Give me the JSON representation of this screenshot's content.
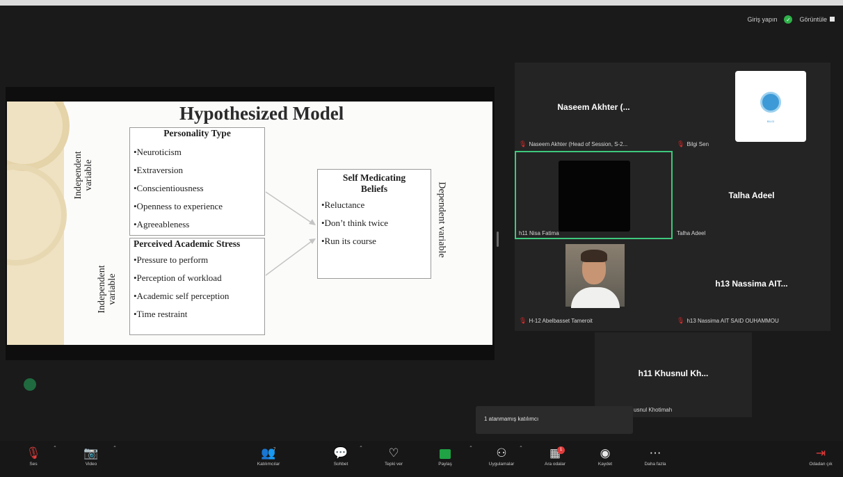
{
  "topbar": {
    "login_label": "Giriş yapın",
    "view_label": "Görüntüle"
  },
  "slide": {
    "title": "Hypothesized Model",
    "box1": {
      "title": "Personality Type",
      "items": [
        "•Neuroticism",
        "•Extraversion",
        "•Conscientiousness",
        "•Openness to experience",
        "•Agreeableness"
      ]
    },
    "box2": {
      "title": "Perceived Academic Stress",
      "items": [
        "•Pressure to perform",
        "•Perception of workload",
        "•Academic self perception",
        "•Time restraint"
      ]
    },
    "box3": {
      "title": "Self Medicating Beliefs",
      "items": [
        "•Reluctance",
        "•Don’t think twice",
        "•Run its course"
      ]
    },
    "label_iv1": "Independent variable",
    "label_iv2": "Independent variable",
    "label_dv": "Dependent variable"
  },
  "participants": [
    {
      "big_name": "Naseem Akhter (...",
      "small_name": "Naseem Akhter (Head of Session, S-2...",
      "muted": true
    },
    {
      "big_name": "",
      "small_name": "Bilgi Sen",
      "muted": true,
      "logo_text": "BİLGİ"
    },
    {
      "big_name": "",
      "small_name": "h11 Nisa Fatima",
      "muted": false,
      "active_speaker": true
    },
    {
      "big_name": "Talha Adeel",
      "small_name": "Talha Adeel",
      "muted": false
    },
    {
      "big_name": "",
      "small_name": "H-12 Abelbasset Tameroit",
      "muted": true
    },
    {
      "big_name": "h13 Nassima AIT...",
      "small_name": "h13 Nassima AIT SAID OUHAMMOU",
      "muted": true
    },
    {
      "big_name": "h11 Khusnul Kh...",
      "small_name": "usnul Khotimah",
      "muted": false
    }
  ],
  "toast": {
    "text": "1 atanmamış katılımcı"
  },
  "toolbar": {
    "audio": "Ses",
    "video": "Video",
    "participants": "Katılımcılar",
    "participants_count": "7",
    "chat": "Sohbet",
    "react": "Tepki ver",
    "share": "Paylaş",
    "apps": "Uygulamalar",
    "breakout": "Ara odalar",
    "breakout_badge": "1",
    "record": "Kaydet",
    "more": "Daha fazla",
    "leave": "Odadan çık"
  },
  "colors": {
    "accent_green": "#3ec97d",
    "muted_red": "#e02828",
    "share_green": "#1fa345"
  },
  "icons": {
    "audio": "mic-off-icon",
    "video": "camera-off-icon",
    "participants": "people-icon",
    "chat": "chat-icon",
    "react": "heart-icon",
    "share": "share-screen-icon",
    "apps": "apps-icon",
    "breakout": "breakout-rooms-icon",
    "record": "record-icon",
    "more": "more-icon",
    "leave": "leave-icon"
  }
}
